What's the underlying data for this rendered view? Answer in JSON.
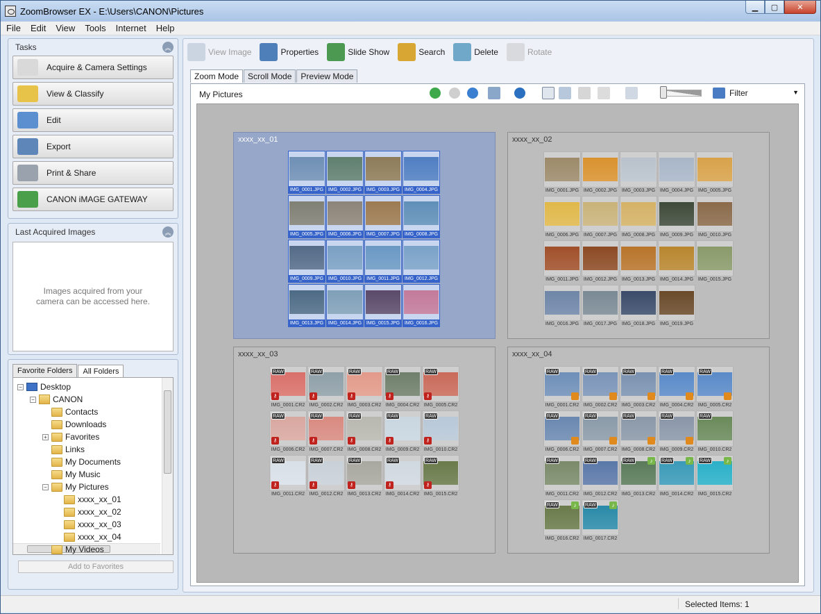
{
  "window": {
    "title": "ZoomBrowser EX  -  E:\\Users\\CANON\\Pictures",
    "minimize": "▁",
    "maximize": "▢",
    "close": "✕"
  },
  "menu": [
    {
      "label": "File"
    },
    {
      "label": "Edit"
    },
    {
      "label": "View"
    },
    {
      "label": "Tools"
    },
    {
      "label": "Internet"
    },
    {
      "label": "Help"
    }
  ],
  "tasks": {
    "title": "Tasks",
    "buttons": [
      {
        "label": "Acquire & Camera Settings",
        "icon": "camera-icon",
        "color": "#d9d9d9"
      },
      {
        "label": "View & Classify",
        "icon": "folder-icon",
        "color": "#e7c34a"
      },
      {
        "label": "Edit",
        "icon": "edit-picture-icon",
        "color": "#5b8fd0"
      },
      {
        "label": "Export",
        "icon": "export-icon",
        "color": "#5f86b8"
      },
      {
        "label": "Print & Share",
        "icon": "printer-icon",
        "color": "#9aa3ad"
      },
      {
        "label": "CANON iMAGE GATEWAY",
        "icon": "globe-icon",
        "color": "#4aa04a"
      }
    ]
  },
  "last_acquired": {
    "title": "Last Acquired Images",
    "message": "Images acquired from your camera can be accessed here."
  },
  "folders": {
    "tabs": [
      "Favorite Folders",
      "All Folders"
    ],
    "active_tab": "All Folders",
    "tree": [
      {
        "label": "Desktop",
        "level": 0,
        "toggle": "−",
        "icon": "desktop"
      },
      {
        "label": "CANON",
        "level": 1,
        "toggle": "−",
        "icon": "user"
      },
      {
        "label": "Contacts",
        "level": 2,
        "toggle": "",
        "icon": "folder"
      },
      {
        "label": "Downloads",
        "level": 2,
        "toggle": "",
        "icon": "folder"
      },
      {
        "label": "Favorites",
        "level": 2,
        "toggle": "+",
        "icon": "folder"
      },
      {
        "label": "Links",
        "level": 2,
        "toggle": "",
        "icon": "folder"
      },
      {
        "label": "My Documents",
        "level": 2,
        "toggle": "",
        "icon": "folder"
      },
      {
        "label": "My Music",
        "level": 2,
        "toggle": "",
        "icon": "folder"
      },
      {
        "label": "My Pictures",
        "level": 2,
        "toggle": "−",
        "icon": "folder"
      },
      {
        "label": "xxxx_xx_01",
        "level": 3,
        "toggle": "",
        "icon": "folder"
      },
      {
        "label": "xxxx_xx_02",
        "level": 3,
        "toggle": "",
        "icon": "folder"
      },
      {
        "label": "xxxx_xx_03",
        "level": 3,
        "toggle": "",
        "icon": "folder"
      },
      {
        "label": "xxxx_xx_04",
        "level": 3,
        "toggle": "",
        "icon": "folder"
      },
      {
        "label": "My Videos",
        "level": 2,
        "toggle": "",
        "icon": "folder"
      }
    ],
    "add_favorites": "Add to Favorites"
  },
  "toolbar": [
    {
      "label": "View Image",
      "icon": "view-image-icon",
      "enabled": false,
      "color": "#8aa0b8"
    },
    {
      "label": "Properties",
      "icon": "properties-icon",
      "enabled": true,
      "color": "#4f7fb8"
    },
    {
      "label": "Slide Show",
      "icon": "slideshow-icon",
      "enabled": true,
      "color": "#4c9a52"
    },
    {
      "label": "Search",
      "icon": "search-icon",
      "enabled": true,
      "color": "#d8a632"
    },
    {
      "label": "Delete",
      "icon": "delete-icon",
      "enabled": true,
      "color": "#6fa8c8"
    },
    {
      "label": "Rotate",
      "icon": "rotate-icon",
      "enabled": false,
      "color": "#b0b0b0"
    }
  ],
  "modes": {
    "tabs": [
      "Zoom Mode",
      "Scroll Mode",
      "Preview Mode"
    ],
    "active": "Zoom Mode"
  },
  "browser": {
    "path": "My Pictures",
    "filter_label": "Filter"
  },
  "groups": [
    {
      "title": "xxxx_xx_01",
      "selected": true,
      "files": [
        {
          "name": "IMG_0001.JPG",
          "color": "#6f8fb5"
        },
        {
          "name": "IMG_0002.JPG",
          "color": "#5f7f6f"
        },
        {
          "name": "IMG_0003.JPG",
          "color": "#8d7b58"
        },
        {
          "name": "IMG_0004.JPG",
          "color": "#4f7ec2"
        },
        {
          "name": "IMG_0005.JPG",
          "color": "#7f7f74"
        },
        {
          "name": "IMG_0006.JPG",
          "color": "#8c8478"
        },
        {
          "name": "IMG_0007.JPG",
          "color": "#9b7a50"
        },
        {
          "name": "IMG_0008.JPG",
          "color": "#5f8fb8"
        },
        {
          "name": "IMG_0009.JPG",
          "color": "#546b88"
        },
        {
          "name": "IMG_0010.JPG",
          "color": "#7aa0c4"
        },
        {
          "name": "IMG_0011.JPG",
          "color": "#6a98c4"
        },
        {
          "name": "IMG_0012.JPG",
          "color": "#7aa2c8"
        },
        {
          "name": "IMG_0013.JPG",
          "color": "#4d6b86"
        },
        {
          "name": "IMG_0014.JPG",
          "color": "#7fa0b8"
        },
        {
          "name": "IMG_0015.JPG",
          "color": "#5b4a6a"
        },
        {
          "name": "IMG_0016.JPG",
          "color": "#c27a9a"
        }
      ]
    },
    {
      "title": "xxxx_xx_02",
      "selected": false,
      "files": [
        {
          "name": "IMG_0001.JPG",
          "color": "#9c8a6a"
        },
        {
          "name": "IMG_0002.JPG",
          "color": "#d9922e"
        },
        {
          "name": "IMG_0003.JPG",
          "color": "#b9c2cc"
        },
        {
          "name": "IMG_0004.JPG",
          "color": "#a8b6c8"
        },
        {
          "name": "IMG_0005.JPG",
          "color": "#d8a24a"
        },
        {
          "name": "IMG_0006.JPG",
          "color": "#e0b84a"
        },
        {
          "name": "IMG_0007.JPG",
          "color": "#c9b37a"
        },
        {
          "name": "IMG_0008.JPG",
          "color": "#d4b266"
        },
        {
          "name": "IMG_0009.JPG",
          "color": "#3e4a3a"
        },
        {
          "name": "IMG_0010.JPG",
          "color": "#8a6a4a"
        },
        {
          "name": "IMG_0011.JPG",
          "color": "#a0502a"
        },
        {
          "name": "IMG_0012.JPG",
          "color": "#8c4a24"
        },
        {
          "name": "IMG_0013.JPG",
          "color": "#b8742a"
        },
        {
          "name": "IMG_0014.JPG",
          "color": "#b8862e"
        },
        {
          "name": "IMG_0015.JPG",
          "color": "#8a9a6a"
        },
        {
          "name": "IMG_0016.JPG",
          "color": "#6f86a8"
        },
        {
          "name": "IMG_0017.JPG",
          "color": "#7a8a94"
        },
        {
          "name": "IMG_0018.JPG",
          "color": "#3a4c6a"
        },
        {
          "name": "IMG_0019.JPG",
          "color": "#6a4a2a"
        }
      ]
    },
    {
      "title": "xxxx_xx_03",
      "selected": false,
      "files": [
        {
          "name": "IMG_0001.CR2",
          "color": "#d9706a",
          "raw": true,
          "key": true
        },
        {
          "name": "IMG_0002.CR2",
          "color": "#8fa0a8",
          "raw": true,
          "key": true
        },
        {
          "name": "IMG_0003.CR2",
          "color": "#e29a8a",
          "raw": true,
          "key": true
        },
        {
          "name": "IMG_0004.CR2",
          "color": "#6f7f6a",
          "raw": true,
          "key": true
        },
        {
          "name": "IMG_0005.CR2",
          "color": "#c96a5a",
          "raw": true,
          "key": true
        },
        {
          "name": "IMG_0006.CR2",
          "color": "#d8a8a0",
          "raw": true,
          "key": true
        },
        {
          "name": "IMG_0007.CR2",
          "color": "#d88a80",
          "raw": true,
          "key": true
        },
        {
          "name": "IMG_0008.CR2",
          "color": "#b8b8b0",
          "raw": true,
          "key": true
        },
        {
          "name": "IMG_0009.CR2",
          "color": "#c8d6e0",
          "raw": true,
          "key": true
        },
        {
          "name": "IMG_0010.CR2",
          "color": "#b8c8d8",
          "raw": true,
          "key": true
        },
        {
          "name": "IMG_0011.CR2",
          "color": "#d8e0e8",
          "raw": true,
          "key": true
        },
        {
          "name": "IMG_0012.CR2",
          "color": "#c8d0d8",
          "raw": true,
          "key": true
        },
        {
          "name": "IMG_0013.CR2",
          "color": "#a8a8a0",
          "raw": true,
          "key": true
        },
        {
          "name": "IMG_0014.CR2",
          "color": "#d0d8e0",
          "raw": true,
          "key": true
        },
        {
          "name": "IMG_0015.CR2",
          "color": "#6a7a4a",
          "raw": true,
          "key": true
        }
      ]
    },
    {
      "title": "xxxx_xx_04",
      "selected": false,
      "files": [
        {
          "name": "IMG_0001.CR2",
          "color": "#6f8fb8",
          "raw": true,
          "stack": true
        },
        {
          "name": "IMG_0002.CR2",
          "color": "#7a94b8",
          "raw": true,
          "stack": true
        },
        {
          "name": "IMG_0003.CR2",
          "color": "#7a92b0",
          "raw": true,
          "stack": true
        },
        {
          "name": "IMG_0004.CR2",
          "color": "#5a8ac8",
          "raw": true,
          "stack": true
        },
        {
          "name": "IMG_0005.CR2",
          "color": "#5a8ac8",
          "raw": true,
          "stack": true
        },
        {
          "name": "IMG_0006.CR2",
          "color": "#6a88b0",
          "raw": true,
          "stack": true
        },
        {
          "name": "IMG_0007.CR2",
          "color": "#8a9aa8",
          "raw": true,
          "stack": true
        },
        {
          "name": "IMG_0008.CR2",
          "color": "#8a98a8",
          "raw": true,
          "stack": true
        },
        {
          "name": "IMG_0009.CR2",
          "color": "#8a96a8",
          "raw": true,
          "stack": true
        },
        {
          "name": "IMG_0010.CR2",
          "color": "#6a8a5a",
          "raw": true
        },
        {
          "name": "IMG_0011.CR2",
          "color": "#7a8a6a",
          "raw": true
        },
        {
          "name": "IMG_0012.CR2",
          "color": "#5a78a8",
          "raw": true
        },
        {
          "name": "IMG_0013.CR2",
          "color": "#5a7a5a",
          "raw": true,
          "sound": true
        },
        {
          "name": "IMG_0014.CR2",
          "color": "#3a9ab8",
          "raw": true,
          "sound": true
        },
        {
          "name": "IMG_0015.CR2",
          "color": "#2ab0c8",
          "raw": true,
          "sound": true
        },
        {
          "name": "IMG_0016.CR2",
          "color": "#6a7a4a",
          "raw": true,
          "sound": true
        },
        {
          "name": "IMG_0017.CR2",
          "color": "#2a8aa8",
          "raw": true,
          "sound": true
        }
      ]
    }
  ],
  "status": {
    "selected": "Selected Items: 1"
  }
}
